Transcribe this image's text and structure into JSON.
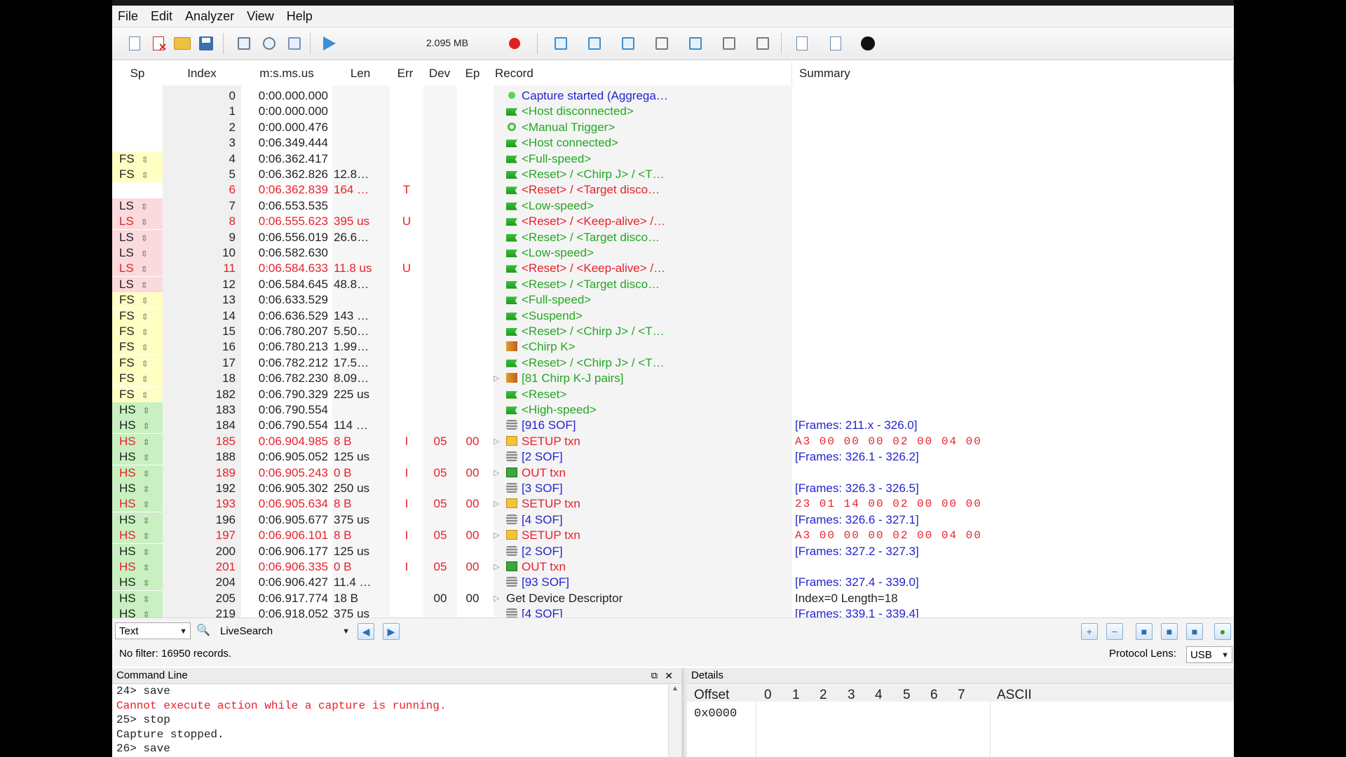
{
  "menu": [
    "File",
    "Edit",
    "Analyzer",
    "View",
    "Help"
  ],
  "toolbar": {
    "file_size": "2.095 MB"
  },
  "columns": {
    "sp": "Sp",
    "index": "Index",
    "time": "m:s.ms.us",
    "len": "Len",
    "err": "Err",
    "dev": "Dev",
    "ep": "Ep",
    "record": "Record",
    "summary": "Summary"
  },
  "rows": [
    {
      "sp": "",
      "idx": "0",
      "time": "0:00.000.000",
      "len": "",
      "err": "",
      "dev": "",
      "ep": "",
      "exp": "",
      "icon": "dot",
      "rec": "Capture started (Aggrega…",
      "sum": "",
      "red": false
    },
    {
      "sp": "",
      "idx": "1",
      "time": "0:00.000.000",
      "len": "",
      "err": "",
      "dev": "",
      "ep": "",
      "exp": "",
      "icon": "flag",
      "rec": "<Host disconnected>",
      "sum": "",
      "red": false
    },
    {
      "sp": "",
      "idx": "2",
      "time": "0:00.000.476",
      "len": "",
      "err": "",
      "dev": "",
      "ep": "",
      "exp": "",
      "icon": "gear",
      "rec": "<Manual Trigger>",
      "sum": "",
      "red": false
    },
    {
      "sp": "",
      "idx": "3",
      "time": "0:06.349.444",
      "len": "",
      "err": "",
      "dev": "",
      "ep": "",
      "exp": "",
      "icon": "flag",
      "rec": "<Host connected>",
      "sum": "",
      "red": false
    },
    {
      "sp": "FS",
      "idx": "4",
      "time": "0:06.362.417",
      "len": "",
      "err": "",
      "dev": "",
      "ep": "",
      "exp": "",
      "icon": "flag",
      "rec": "<Full-speed>",
      "sum": "",
      "red": false
    },
    {
      "sp": "FS",
      "idx": "5",
      "time": "0:06.362.826",
      "len": "12.8…",
      "err": "",
      "dev": "",
      "ep": "",
      "exp": "",
      "icon": "flag",
      "rec": "<Reset> / <Chirp J> / <T…",
      "sum": "",
      "red": false
    },
    {
      "sp": "",
      "idx": "6",
      "time": "0:06.362.839",
      "len": "164 …",
      "err": "T",
      "dev": "",
      "ep": "",
      "exp": "",
      "icon": "flag",
      "rec": "<Reset> / <Target disco…",
      "sum": "",
      "red": true
    },
    {
      "sp": "LS",
      "idx": "7",
      "time": "0:06.553.535",
      "len": "",
      "err": "",
      "dev": "",
      "ep": "",
      "exp": "",
      "icon": "flag",
      "rec": "<Low-speed>",
      "sum": "",
      "red": false
    },
    {
      "sp": "LS",
      "idx": "8",
      "time": "0:06.555.623",
      "len": "395 us",
      "err": "U",
      "dev": "",
      "ep": "",
      "exp": "",
      "icon": "flag",
      "rec": "<Reset> / <Keep-alive> /…",
      "sum": "",
      "red": true
    },
    {
      "sp": "LS",
      "idx": "9",
      "time": "0:06.556.019",
      "len": "26.6…",
      "err": "",
      "dev": "",
      "ep": "",
      "exp": "",
      "icon": "flag",
      "rec": "<Reset> / <Target disco…",
      "sum": "",
      "red": false
    },
    {
      "sp": "LS",
      "idx": "10",
      "time": "0:06.582.630",
      "len": "",
      "err": "",
      "dev": "",
      "ep": "",
      "exp": "",
      "icon": "flag",
      "rec": "<Low-speed>",
      "sum": "",
      "red": false
    },
    {
      "sp": "LS",
      "idx": "11",
      "time": "0:06.584.633",
      "len": "11.8 us",
      "err": "U",
      "dev": "",
      "ep": "",
      "exp": "",
      "icon": "flag",
      "rec": "<Reset> / <Keep-alive> /…",
      "sum": "",
      "red": true
    },
    {
      "sp": "LS",
      "idx": "12",
      "time": "0:06.584.645",
      "len": "48.8…",
      "err": "",
      "dev": "",
      "ep": "",
      "exp": "",
      "icon": "flag",
      "rec": "<Reset> / <Target disco…",
      "sum": "",
      "red": false
    },
    {
      "sp": "FS",
      "idx": "13",
      "time": "0:06.633.529",
      "len": "",
      "err": "",
      "dev": "",
      "ep": "",
      "exp": "",
      "icon": "flag",
      "rec": "<Full-speed>",
      "sum": "",
      "red": false
    },
    {
      "sp": "FS",
      "idx": "14",
      "time": "0:06.636.529",
      "len": "143 …",
      "err": "",
      "dev": "",
      "ep": "",
      "exp": "",
      "icon": "flag",
      "rec": "<Suspend>",
      "sum": "",
      "red": false
    },
    {
      "sp": "FS",
      "idx": "15",
      "time": "0:06.780.207",
      "len": "5.50…",
      "err": "",
      "dev": "",
      "ep": "",
      "exp": "",
      "icon": "flag",
      "rec": "<Reset> / <Chirp J> / <T…",
      "sum": "",
      "red": false
    },
    {
      "sp": "FS",
      "idx": "16",
      "time": "0:06.780.213",
      "len": "1.99…",
      "err": "",
      "dev": "",
      "ep": "",
      "exp": "",
      "icon": "chirp",
      "rec": "<Chirp K>",
      "sum": "",
      "red": false
    },
    {
      "sp": "FS",
      "idx": "17",
      "time": "0:06.782.212",
      "len": "17.5…",
      "err": "",
      "dev": "",
      "ep": "",
      "exp": "",
      "icon": "flag",
      "rec": "<Reset> / <Chirp J> / <T…",
      "sum": "",
      "red": false
    },
    {
      "sp": "FS",
      "idx": "18",
      "time": "0:06.782.230",
      "len": "8.09…",
      "err": "",
      "dev": "",
      "ep": "",
      "exp": "▷",
      "icon": "chirp",
      "rec": "[81 Chirp K-J pairs]",
      "sum": "",
      "red": false
    },
    {
      "sp": "FS",
      "idx": "182",
      "time": "0:06.790.329",
      "len": "225 us",
      "err": "",
      "dev": "",
      "ep": "",
      "exp": "",
      "icon": "flag",
      "rec": "<Reset>",
      "sum": "",
      "red": false
    },
    {
      "sp": "HS",
      "idx": "183",
      "time": "0:06.790.554",
      "len": "",
      "err": "",
      "dev": "",
      "ep": "",
      "exp": "",
      "icon": "flag",
      "rec": "<High-speed>",
      "sum": "",
      "red": false
    },
    {
      "sp": "HS",
      "idx": "184",
      "time": "0:06.790.554",
      "len": "114 …",
      "err": "",
      "dev": "",
      "ep": "",
      "exp": "",
      "icon": "sof",
      "rec": "[916 SOF]",
      "sum": "[Frames: 211.x - 326.0]",
      "red": false
    },
    {
      "sp": "HS",
      "idx": "185",
      "time": "0:06.904.985",
      "len": "8 B",
      "err": "I",
      "dev": "05",
      "ep": "00",
      "exp": "▷",
      "icon": "setup",
      "rec": "SETUP txn",
      "sum": "A3 00 00 00 02 00 04 00",
      "red": true
    },
    {
      "sp": "HS",
      "idx": "188",
      "time": "0:06.905.052",
      "len": "125 us",
      "err": "",
      "dev": "",
      "ep": "",
      "exp": "",
      "icon": "sof",
      "rec": "[2 SOF]",
      "sum": "[Frames: 326.1 - 326.2]",
      "red": false
    },
    {
      "sp": "HS",
      "idx": "189",
      "time": "0:06.905.243",
      "len": "0 B",
      "err": "I",
      "dev": "05",
      "ep": "00",
      "exp": "▷",
      "icon": "out",
      "rec": "OUT txn",
      "sum": "",
      "red": true
    },
    {
      "sp": "HS",
      "idx": "192",
      "time": "0:06.905.302",
      "len": "250 us",
      "err": "",
      "dev": "",
      "ep": "",
      "exp": "",
      "icon": "sof",
      "rec": "[3 SOF]",
      "sum": "[Frames: 326.3 - 326.5]",
      "red": false
    },
    {
      "sp": "HS",
      "idx": "193",
      "time": "0:06.905.634",
      "len": "8 B",
      "err": "I",
      "dev": "05",
      "ep": "00",
      "exp": "▷",
      "icon": "setup",
      "rec": "SETUP txn",
      "sum": "23 01 14 00 02 00 00 00",
      "red": true
    },
    {
      "sp": "HS",
      "idx": "196",
      "time": "0:06.905.677",
      "len": "375 us",
      "err": "",
      "dev": "",
      "ep": "",
      "exp": "",
      "icon": "sof",
      "rec": "[4 SOF]",
      "sum": "[Frames: 326.6 - 327.1]",
      "red": false
    },
    {
      "sp": "HS",
      "idx": "197",
      "time": "0:06.906.101",
      "len": "8 B",
      "err": "I",
      "dev": "05",
      "ep": "00",
      "exp": "▷",
      "icon": "setup",
      "rec": "SETUP txn",
      "sum": "A3 00 00 00 02 00 04 00",
      "red": true
    },
    {
      "sp": "HS",
      "idx": "200",
      "time": "0:06.906.177",
      "len": "125 us",
      "err": "",
      "dev": "",
      "ep": "",
      "exp": "",
      "icon": "sof",
      "rec": "[2 SOF]",
      "sum": "[Frames: 327.2 - 327.3]",
      "red": false
    },
    {
      "sp": "HS",
      "idx": "201",
      "time": "0:06.906.335",
      "len": "0 B",
      "err": "I",
      "dev": "05",
      "ep": "00",
      "exp": "▷",
      "icon": "out",
      "rec": "OUT txn",
      "sum": "",
      "red": true
    },
    {
      "sp": "HS",
      "idx": "204",
      "time": "0:06.906.427",
      "len": "11.4 …",
      "err": "",
      "dev": "",
      "ep": "",
      "exp": "",
      "icon": "sof",
      "rec": "[93 SOF]",
      "sum": "[Frames: 327.4 - 339.0]",
      "red": false
    },
    {
      "sp": "HS",
      "idx": "205",
      "time": "0:06.917.774",
      "len": "18 B",
      "err": "",
      "dev": "00",
      "ep": "00",
      "exp": "▷",
      "icon": "none",
      "rec": "Get Device Descriptor",
      "sum": "Index=0 Length=18",
      "red": false
    },
    {
      "sp": "HS",
      "idx": "219",
      "time": "0:06.918.052",
      "len": "375 us",
      "err": "",
      "dev": "",
      "ep": "",
      "exp": "",
      "icon": "sof",
      "rec": "[4 SOF]",
      "sum": "[Frames: 339.1 - 339.4]",
      "red": false
    }
  ],
  "filterbar": {
    "type": "Text",
    "search": "LiveSearch"
  },
  "status": {
    "records": "No filter: 16950 records.",
    "lens_label": "Protocol Lens:",
    "lens_value": "USB"
  },
  "command_line": {
    "title": "Command Line",
    "lines": [
      {
        "text": "24> save",
        "red": false
      },
      {
        "text": "Cannot execute action while a capture is running.",
        "red": true
      },
      {
        "text": "25> stop",
        "red": false
      },
      {
        "text": "Capture stopped.",
        "red": false
      },
      {
        "text": "26> save",
        "red": false
      }
    ]
  },
  "details": {
    "title": "Details",
    "offset": "Offset",
    "cols": [
      "0",
      "1",
      "2",
      "3",
      "4",
      "5",
      "6",
      "7"
    ],
    "ascii": "ASCII",
    "first_offset": "0x0000"
  },
  "colors": {
    "fs_bg": "#ffffc4",
    "ls_bg": "#fadadd",
    "hs_bg": "#c8f0c0",
    "green_text": "#22a822",
    "blue_text": "#2323d0",
    "red_text": "#e8202a"
  }
}
